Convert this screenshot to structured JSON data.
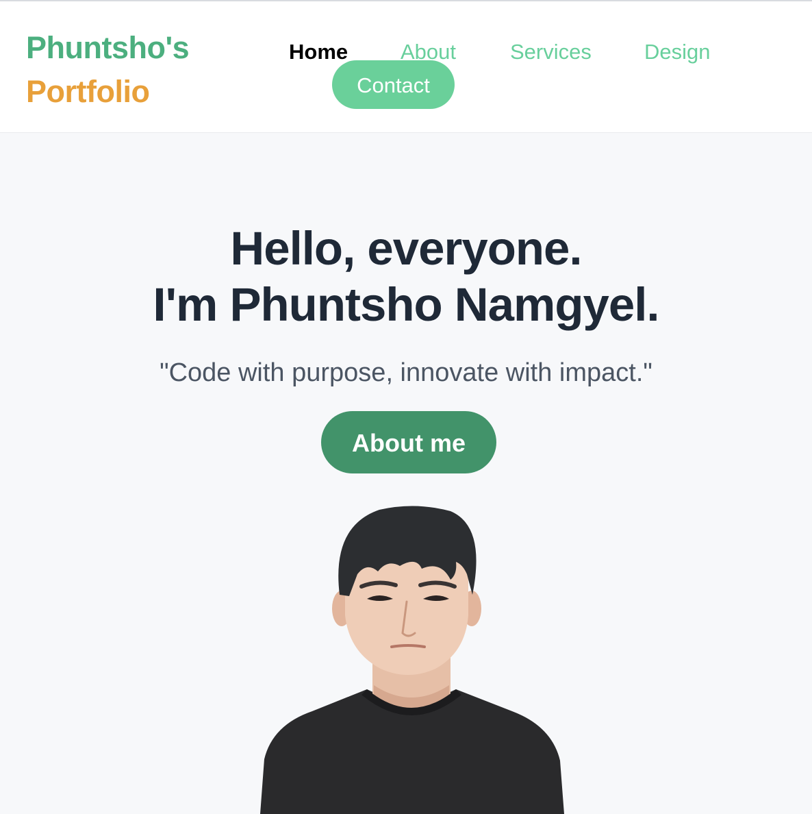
{
  "header": {
    "logo": {
      "line1": "Phuntsho's",
      "line2": "Portfolio"
    },
    "nav": {
      "items": [
        {
          "label": "Home",
          "active": true
        },
        {
          "label": "About",
          "active": false
        },
        {
          "label": "Services",
          "active": false
        },
        {
          "label": "Design",
          "active": false
        }
      ],
      "contact_label": "Contact"
    }
  },
  "hero": {
    "title_line1": "Hello, everyone.",
    "title_line2": "I'm Phuntsho Namgyel.",
    "quote": "\"Code with purpose, innovate with impact.\"",
    "cta_label": "About me"
  },
  "colors": {
    "brand_green": "#4caf7f",
    "brand_orange": "#e8a03a",
    "nav_green": "#68cf9c",
    "cta_green": "#42936a",
    "heading": "#1f2937",
    "page_bg": "#f7f8fa"
  }
}
